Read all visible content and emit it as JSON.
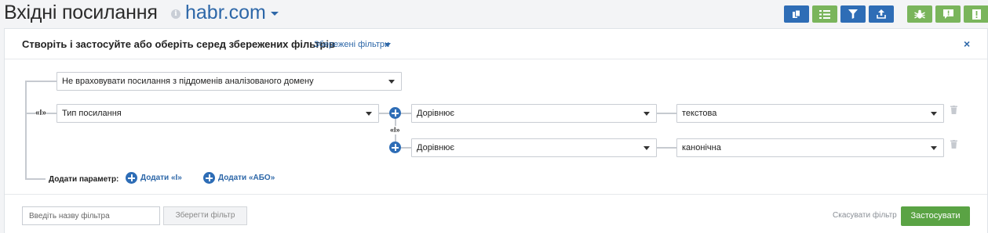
{
  "header": {
    "title": "Вхідні посилання",
    "info_icon": "i",
    "domain": "habr.com",
    "toolbar": [
      {
        "name": "copy-button",
        "icon": "copy-icon",
        "color": "#2e6db6"
      },
      {
        "name": "columns-button",
        "icon": "columns-icon",
        "color": "#7ab55c"
      },
      {
        "name": "filter-button",
        "icon": "filter-icon",
        "color": "#2e6db6"
      },
      {
        "name": "export-button",
        "icon": "upload-icon",
        "color": "#2e6db6"
      },
      {
        "name": "crawler-button",
        "icon": "bug-icon",
        "color": "#7ab55c"
      },
      {
        "name": "feedback-button",
        "icon": "comment-alert-icon",
        "color": "#7ab55c"
      },
      {
        "name": "report-button",
        "icon": "alert-icon",
        "color": "#7ab55c"
      }
    ]
  },
  "panel": {
    "title": "Створіть і застосуйте або оберіть серед збережених фільтрів",
    "saved_filters": "Збережені фільтри",
    "close": "×"
  },
  "conditions": {
    "subdomain_select": "Не враховувати посилання з піддоменів аналізованого домену",
    "and_label": "«І»",
    "link_type_select": "Тип посилання",
    "inner_and_label": "«І»",
    "rows": [
      {
        "operator": "Дорівнює",
        "value": "текстова"
      },
      {
        "operator": "Дорівнює",
        "value": "канонічна"
      }
    ]
  },
  "add_param": {
    "label": "Додати параметр:",
    "add_and": "Додати «І»",
    "add_or": "Додати «АБО»"
  },
  "footer": {
    "filter_name_placeholder": "Введіть назву фільтра",
    "save_filter": "Зберегти фільтр",
    "cancel_filter": "Скасувати фільтр",
    "apply": "Застосувати"
  },
  "colors": {
    "primary_blue": "#2e6db6",
    "green": "#7ab55c",
    "apply_green": "#5aa344",
    "link_blue": "#2d67a8"
  }
}
